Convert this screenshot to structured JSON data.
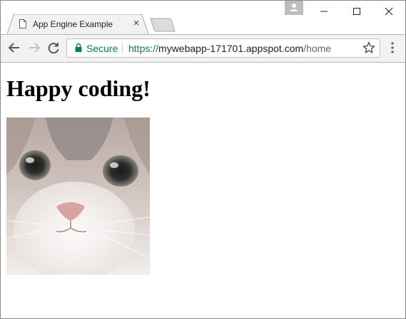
{
  "browser": {
    "tab": {
      "title": "App Engine Example",
      "close_glyph": "×",
      "icon": "document-icon"
    },
    "window_controls": [
      "minimize-icon",
      "maximize-icon",
      "close-icon"
    ],
    "toolbar": {
      "secure_label": "Secure",
      "url": {
        "scheme": "https://",
        "host": "mywebapp-171701.appspot.com",
        "path": "/home"
      },
      "icons": [
        "back-arrow-icon",
        "forward-arrow-icon",
        "reload-icon",
        "lock-icon",
        "star-icon",
        "menu-icon"
      ]
    },
    "colors": {
      "secure": "#0b8043",
      "toolbar_bg": "#f2f2f2",
      "tab_bg": "#f2f2f2"
    }
  },
  "page": {
    "heading": "Happy coding!",
    "image": {
      "subject": "kitten face photo"
    }
  }
}
